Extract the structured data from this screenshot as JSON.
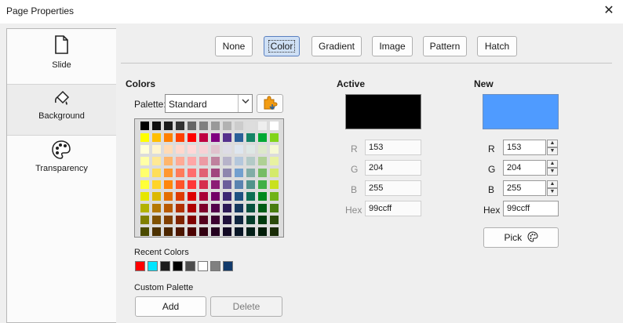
{
  "window": {
    "title": "Page Properties",
    "close_glyph": "✕"
  },
  "sidebar": {
    "items": [
      {
        "label": "Slide",
        "icon": "page-icon"
      },
      {
        "label": "Background",
        "icon": "paint-bucket-icon"
      },
      {
        "label": "Transparency",
        "icon": "palette-icon"
      }
    ]
  },
  "tabs": [
    "None",
    "Color",
    "Gradient",
    "Image",
    "Pattern",
    "Hatch"
  ],
  "colors": {
    "heading": "Colors",
    "palette_label": "Palette:",
    "palette_value": "Standard",
    "palette_grid": [
      [
        "#000000",
        "#111111",
        "#1c1c1c",
        "#333333",
        "#666666",
        "#808080",
        "#999999",
        "#b2b2b2",
        "#cccccc",
        "#dddddd",
        "#eeeeee",
        "#ffffff"
      ],
      [
        "#ffff00",
        "#ffbf00",
        "#ff8000",
        "#ff4000",
        "#ff0000",
        "#bf0041",
        "#800080",
        "#55308d",
        "#2a6099",
        "#158466",
        "#00a933",
        "#81d41a"
      ],
      [
        "#ffffd7",
        "#fff5ce",
        "#ffdbb6",
        "#ffd8ce",
        "#ffd7d7",
        "#f7d1d5",
        "#e0c2cd",
        "#dedce6",
        "#dee6ef",
        "#dee7e5",
        "#dde8cb",
        "#f6f9d4"
      ],
      [
        "#ffffa6",
        "#ffe994",
        "#ffb66c",
        "#ffaa95",
        "#ffa6a6",
        "#ec9ba4",
        "#bf819e",
        "#b7b3ca",
        "#b4c7dc",
        "#b3cac7",
        "#afd095",
        "#e8f2a1"
      ],
      [
        "#ffff6d",
        "#ffde59",
        "#ff972f",
        "#ff7b59",
        "#ff6d6d",
        "#e16173",
        "#a1467e",
        "#8e86ae",
        "#729fcf",
        "#81aca6",
        "#77bc65",
        "#d4ea6b"
      ],
      [
        "#ffff38",
        "#ffd428",
        "#ff860d",
        "#ff5429",
        "#ff3838",
        "#d62e4e",
        "#8d1d75",
        "#6b5e9b",
        "#5983b0",
        "#50938a",
        "#3faf46",
        "#c9e11e"
      ],
      [
        "#e6e600",
        "#dcb900",
        "#e46e00",
        "#de3b00",
        "#de0000",
        "#a90035",
        "#730066",
        "#3d2773",
        "#1e5181",
        "#0d6e53",
        "#00881e",
        "#6fb319"
      ],
      [
        "#b2b200",
        "#b47804",
        "#b85a00",
        "#b13100",
        "#b00000",
        "#7e002b",
        "#54004b",
        "#2d1a56",
        "#15385f",
        "#07513e",
        "#005b15",
        "#497d10"
      ],
      [
        "#808000",
        "#7f5102",
        "#803f00",
        "#7f2300",
        "#800000",
        "#55001d",
        "#3c0030",
        "#20113b",
        "#0f253f",
        "#033d2a",
        "#003a0e",
        "#2a4a0a"
      ],
      [
        "#4c4c00",
        "#4c3101",
        "#4c2600",
        "#4c1500",
        "#4c0000",
        "#330011",
        "#24001f",
        "#130a24",
        "#091626",
        "#021e17",
        "#001c07",
        "#192c06"
      ]
    ],
    "recent_label": "Recent Colors",
    "recent": [
      "#ff0000",
      "#00e5ff",
      "#1a1a1a",
      "#000000",
      "#4d4d4d",
      "#ffffff",
      "#808080",
      "#123a6b"
    ],
    "custom_label": "Custom Palette",
    "add_label": "Add",
    "delete_label": "Delete"
  },
  "active": {
    "heading": "Active",
    "swatch": "#000000",
    "r_label": "R",
    "r": "153",
    "g_label": "G",
    "g": "204",
    "b_label": "B",
    "b": "255",
    "hex_label": "Hex",
    "hex": "99ccff"
  },
  "new": {
    "heading": "New",
    "swatch": "#4f9bff",
    "r_label": "R",
    "r": "153",
    "g_label": "G",
    "g": "204",
    "b_label": "B",
    "b": "255",
    "hex_label": "Hex",
    "hex": "99ccff",
    "pick_label": "Pick"
  }
}
